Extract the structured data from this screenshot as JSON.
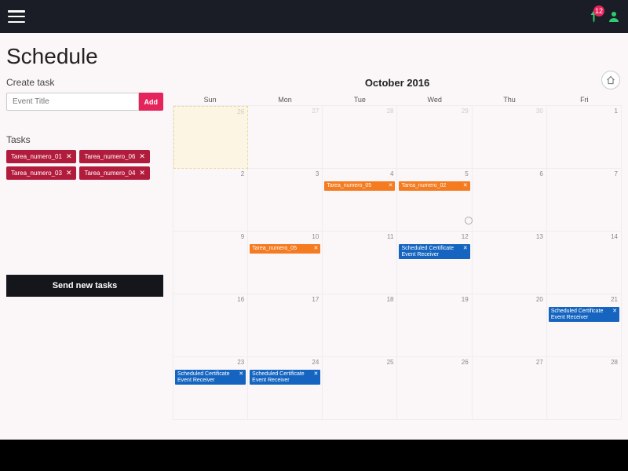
{
  "header": {
    "notif_count": "12"
  },
  "page_title": "Schedule",
  "sidebar": {
    "create_label": "Create task",
    "input_placeholder": "Event Title",
    "add_label": "Add",
    "tasks_label": "Tasks",
    "chips": [
      "Tarea_numero_01",
      "Tarea_numero_06",
      "Tarea_numero_03",
      "Tarea_numero_04"
    ],
    "send_label": "Send new tasks"
  },
  "calendar": {
    "title": "October 2016",
    "dow": [
      "Sun",
      "Mon",
      "Tue",
      "Wed",
      "Thu",
      "Fri"
    ],
    "weeks": [
      [
        {
          "n": "26",
          "other": true,
          "hl": true,
          "evts": []
        },
        {
          "n": "27",
          "other": true,
          "evts": []
        },
        {
          "n": "28",
          "other": true,
          "evts": []
        },
        {
          "n": "29",
          "other": true,
          "evts": []
        },
        {
          "n": "30",
          "other": true,
          "evts": []
        },
        {
          "n": "1",
          "evts": []
        }
      ],
      [
        {
          "n": "2",
          "evts": []
        },
        {
          "n": "3",
          "evts": []
        },
        {
          "n": "4",
          "evts": [
            {
              "t": "Tarea_numero_05",
              "c": "orange"
            }
          ]
        },
        {
          "n": "5",
          "evts": [
            {
              "t": "Tarea_numero_02",
              "c": "orange"
            }
          ]
        },
        {
          "n": "6",
          "evts": []
        },
        {
          "n": "7",
          "evts": []
        }
      ],
      [
        {
          "n": "9",
          "evts": []
        },
        {
          "n": "10",
          "evts": [
            {
              "t": "Tarea_numero_05",
              "c": "orange"
            }
          ]
        },
        {
          "n": "11",
          "evts": []
        },
        {
          "n": "12",
          "evts": [
            {
              "t": "Scheduled Certificate Event Receiver",
              "c": "blue"
            }
          ]
        },
        {
          "n": "13",
          "evts": []
        },
        {
          "n": "14",
          "evts": []
        }
      ],
      [
        {
          "n": "16",
          "evts": []
        },
        {
          "n": "17",
          "evts": []
        },
        {
          "n": "18",
          "evts": []
        },
        {
          "n": "19",
          "evts": []
        },
        {
          "n": "20",
          "evts": []
        },
        {
          "n": "21",
          "evts": [
            {
              "t": "Scheduled Certificate Event Receiver",
              "c": "blue"
            }
          ]
        }
      ],
      [
        {
          "n": "23",
          "evts": [
            {
              "t": "Scheduled Certificate Event Receiver",
              "c": "blue"
            }
          ]
        },
        {
          "n": "24",
          "evts": [
            {
              "t": "Scheduled Certificate Event Receiver",
              "c": "blue"
            }
          ]
        },
        {
          "n": "25",
          "evts": []
        },
        {
          "n": "26",
          "evts": []
        },
        {
          "n": "27",
          "evts": []
        },
        {
          "n": "28",
          "evts": []
        }
      ]
    ]
  }
}
